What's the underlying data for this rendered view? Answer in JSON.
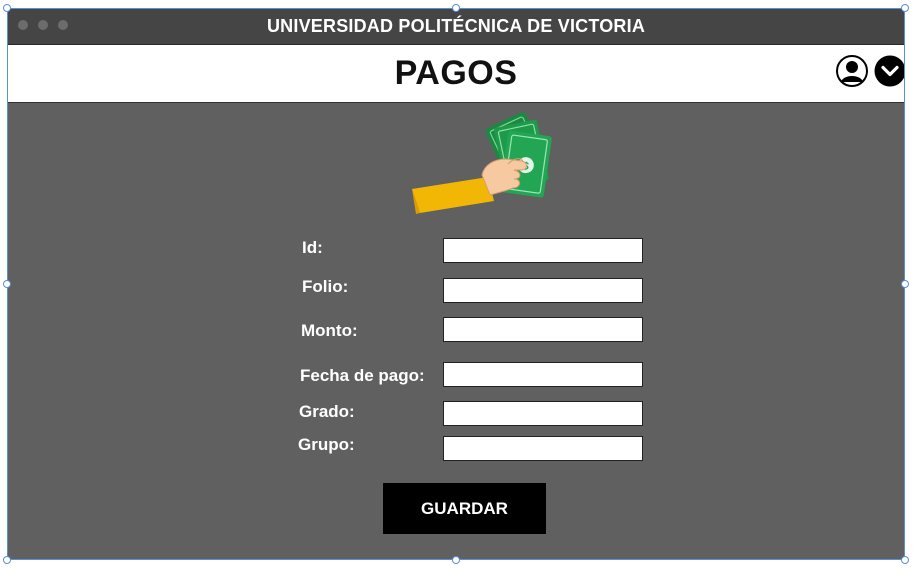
{
  "window": {
    "title": "UNIVERSIDAD POLITÉCNICA DE VICTORIA"
  },
  "header": {
    "title": "PAGOS",
    "icons": [
      "user-icon",
      "chevron-down-icon"
    ]
  },
  "illustration": {
    "icon": "hand-money-icon"
  },
  "form": {
    "fields": [
      {
        "label": "Id:",
        "value": ""
      },
      {
        "label": "Folio:",
        "value": ""
      },
      {
        "label": "Monto:",
        "value": ""
      },
      {
        "label": "Fecha de pago:",
        "value": ""
      },
      {
        "label": "Grado:",
        "value": ""
      },
      {
        "label": "Grupo:",
        "value": ""
      }
    ],
    "submit_label": "GUARDAR"
  },
  "colors": {
    "titlebar": "#454545",
    "background": "#606060",
    "header": "#ffffff",
    "button": "#000000",
    "money": "#1e9a4a",
    "sleeve": "#f2b705"
  }
}
